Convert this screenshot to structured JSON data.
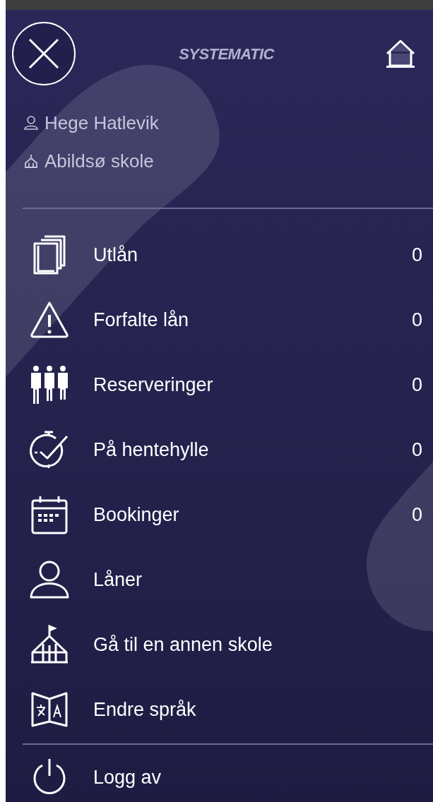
{
  "header": {
    "logo": "SYSTEMATIC"
  },
  "user": {
    "name": "Hege Hatlevik",
    "school": "Abildsø skole"
  },
  "menu": [
    {
      "label": "Utlån",
      "count": "0"
    },
    {
      "label": "Forfalte lån",
      "count": "0"
    },
    {
      "label": "Reserveringer",
      "count": "0"
    },
    {
      "label": "På hentehylle",
      "count": "0"
    },
    {
      "label": "Bookinger",
      "count": "0"
    },
    {
      "label": "Låner"
    },
    {
      "label": "Gå til en annen skole"
    },
    {
      "label": "Endre språk"
    }
  ],
  "logout": {
    "label": "Logg av"
  }
}
